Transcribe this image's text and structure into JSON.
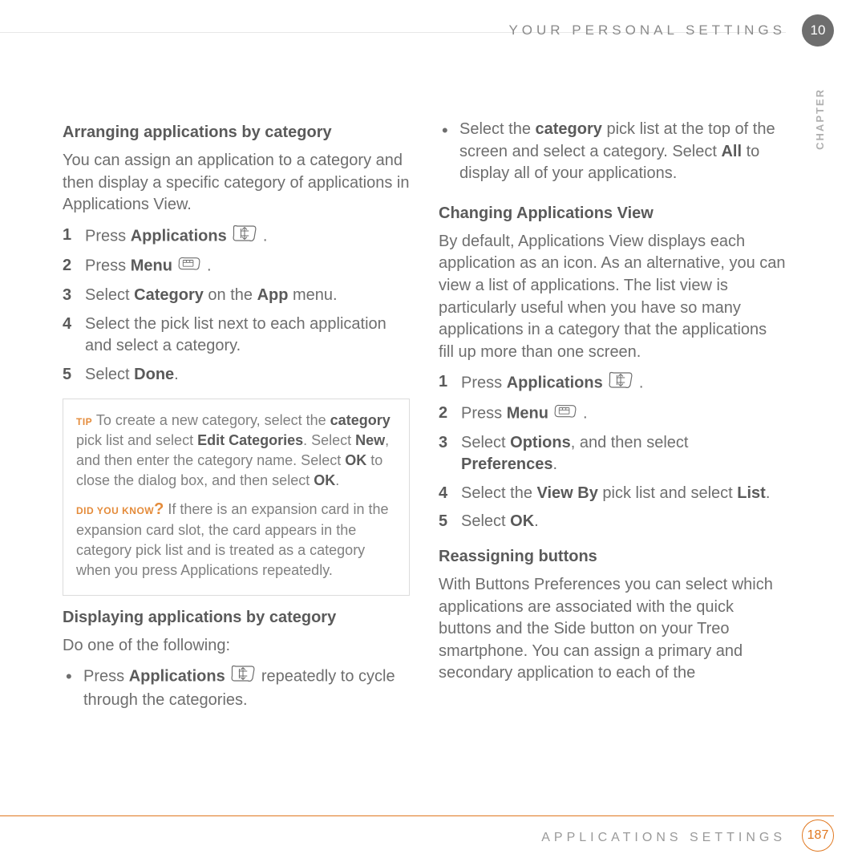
{
  "header": {
    "title": "YOUR PERSONAL SETTINGS",
    "chapter_number": "10",
    "chapter_label": "CHAPTER"
  },
  "left": {
    "h_arranging": "Arranging applications by category",
    "p_arranging": "You can assign an application to a category and then display a specific category of applications in Applications View.",
    "steps1": {
      "s1_pre": "Press ",
      "s1_b": "Applications",
      "s1_post": " .",
      "s2_pre": "Press ",
      "s2_b": "Menu",
      "s2_post": " .",
      "s3_pre": "Select ",
      "s3_b1": "Category",
      "s3_mid": " on the ",
      "s3_b2": "App",
      "s3_post": " menu.",
      "s4": "Select the pick list next to each application and select a category.",
      "s5_pre": "Select ",
      "s5_b": "Done",
      "s5_post": "."
    },
    "callout": {
      "tip_label": "TIP",
      "tip_pre": " To create a new category, select the ",
      "tip_b1": "category",
      "tip_mid1": " pick list and select ",
      "tip_b2": "Edit Categories",
      "tip_mid2": ". Select ",
      "tip_b3": "New",
      "tip_mid3": ", and then enter the category name. Select ",
      "tip_b4": "OK",
      "tip_mid4": " to close the dialog box, and then select ",
      "tip_b5": "OK",
      "tip_post": ".",
      "dyk_label": "DID YOU KNOW",
      "dyk_q": "?",
      "dyk_body": " If there is an expansion card in the expansion card slot, the card appears in the category pick list and is treated as a category when you press Applications repeatedly."
    },
    "h_displaying": "Displaying applications by category",
    "p_displaying": "Do one of the following:",
    "bul1_pre": "Press ",
    "bul1_b": "Applications",
    "bul1_post": " repeatedly to cycle through the categories."
  },
  "right": {
    "bul2_pre": "Select the ",
    "bul2_b1": "category",
    "bul2_mid": " pick list at the top of the screen and select a category. Select ",
    "bul2_b2": "All",
    "bul2_post": " to display all of your applications.",
    "h_changing": "Changing Applications View",
    "p_changing": "By default, Applications View displays each application as an icon. As an alternative, you can view a list of applications. The list view is particularly useful when you have so many applications in a category that the applications fill up more than one screen.",
    "steps2": {
      "s1_pre": "Press ",
      "s1_b": "Applications",
      "s1_post": " .",
      "s2_pre": "Press ",
      "s2_b": "Menu",
      "s2_post": " .",
      "s3_pre": "Select ",
      "s3_b1": "Options",
      "s3_mid": ", and then select ",
      "s3_b2": "Preferences",
      "s3_post": ".",
      "s4_pre": "Select the ",
      "s4_b1": "View By",
      "s4_mid": " pick list and select ",
      "s4_b2": "List",
      "s4_post": ".",
      "s5_pre": "Select ",
      "s5_b": "OK",
      "s5_post": "."
    },
    "h_reassign": "Reassigning buttons",
    "p_reassign": "With Buttons Preferences you can select which applications are associated with the quick buttons and the Side button on your Treo smartphone. You can assign a primary and secondary application to each of the"
  },
  "footer": {
    "title": "APPLICATIONS SETTINGS",
    "page": "187"
  }
}
